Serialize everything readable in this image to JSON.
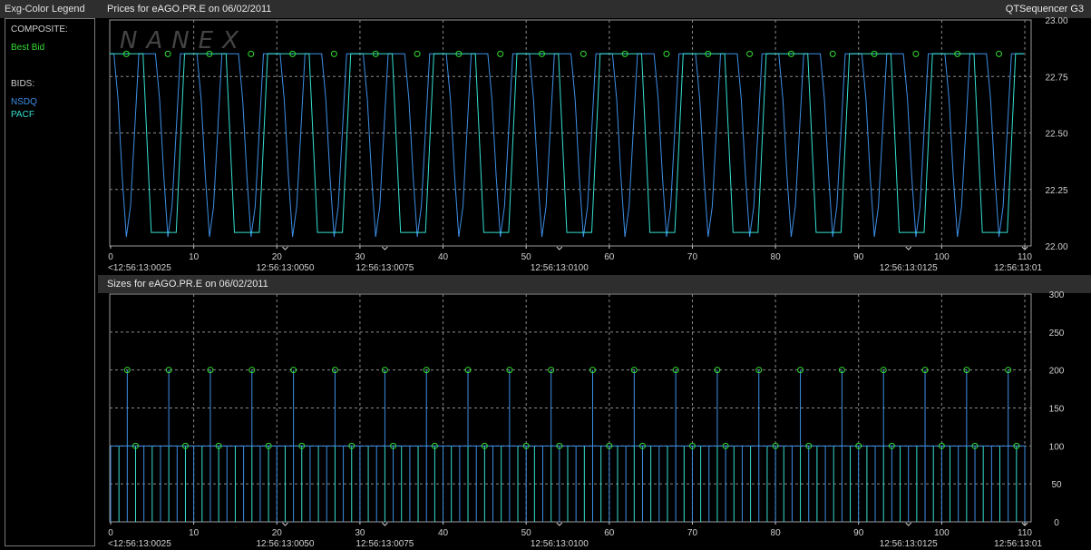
{
  "legend": {
    "header": "Exg-Color Legend",
    "composite_label": "COMPOSITE:",
    "composite_items": [
      {
        "label": "Best Bid",
        "color": "#33dd33"
      }
    ],
    "bids_label": "BIDS:",
    "bid_items": [
      {
        "label": "NSDQ",
        "color": "#3d8fe6"
      },
      {
        "label": "PACF",
        "color": "#35e0d0"
      }
    ]
  },
  "app_title": "QTSequencer G3",
  "watermark": "NANEX",
  "chart_data": [
    {
      "type": "line",
      "title": "Prices for  eAGO.PR.E  on  06/02/2011",
      "x_ticks": [
        0,
        10,
        20,
        30,
        40,
        50,
        60,
        70,
        80,
        90,
        100,
        110
      ],
      "xlim": [
        0,
        110
      ],
      "time_labels": [
        {
          "x": 0,
          "label": "<12:56:13:0025"
        },
        {
          "x": 21,
          "label": "12:56:13:0050"
        },
        {
          "x": 33,
          "label": "12:56:13:0075"
        },
        {
          "x": 54,
          "label": "12:56:13:0100"
        },
        {
          "x": 96,
          "label": "12:56:13:0125"
        },
        {
          "x": 110,
          "label": "12:56:13:01"
        }
      ],
      "y_ticks": [
        "23.00",
        "22.75",
        "22.50",
        "22.25",
        "22.00"
      ],
      "ylim": [
        22.0,
        23.0
      ],
      "grid": true,
      "series": [
        {
          "color": "#3d8fe6",
          "high": 22.85,
          "low": 22.04,
          "cycles_x": [
            5,
            15,
            25,
            35,
            45,
            55,
            65,
            75,
            85,
            95,
            105
          ],
          "note_pattern": "oscillating"
        },
        {
          "color": "#35e0d0",
          "high": 22.85,
          "low": 22.06
        }
      ],
      "best_bid_price": 22.85,
      "best_bid_color": "#33dd33"
    },
    {
      "type": "bar",
      "title": "Sizes for  eAGO.PR.E  on  06/02/2011",
      "x_ticks": [
        0,
        10,
        20,
        30,
        40,
        50,
        60,
        70,
        80,
        90,
        100,
        110
      ],
      "xlim": [
        0,
        110
      ],
      "time_labels": [
        {
          "x": 0,
          "label": "<12:56:13:0025"
        },
        {
          "x": 21,
          "label": "12:56:13:0050"
        },
        {
          "x": 33,
          "label": "12:56:13:0075"
        },
        {
          "x": 54,
          "label": "12:56:13:0100"
        },
        {
          "x": 96,
          "label": "12:56:13:0125"
        },
        {
          "x": 110,
          "label": "12:56:13:01"
        }
      ],
      "y_ticks": [
        "300",
        "250",
        "200",
        "150",
        "100",
        "50",
        "0"
      ],
      "ylim": [
        0,
        300
      ],
      "grid": true,
      "baseline_size": 100,
      "peak_size": 200,
      "peak_x": [
        2,
        7,
        12,
        17,
        22,
        27,
        33,
        38,
        43,
        48,
        53,
        58,
        63,
        68,
        73,
        78,
        83,
        88,
        93,
        98,
        103,
        108
      ],
      "mid_x": [
        3,
        9,
        13,
        19,
        23,
        29,
        34,
        39,
        45,
        50,
        54,
        60,
        64,
        70,
        74,
        80,
        84,
        90,
        94,
        100,
        104,
        109
      ],
      "bar_colors": [
        "#3d8fe6",
        "#35e0d0"
      ],
      "marker_color": "#33dd33"
    }
  ]
}
